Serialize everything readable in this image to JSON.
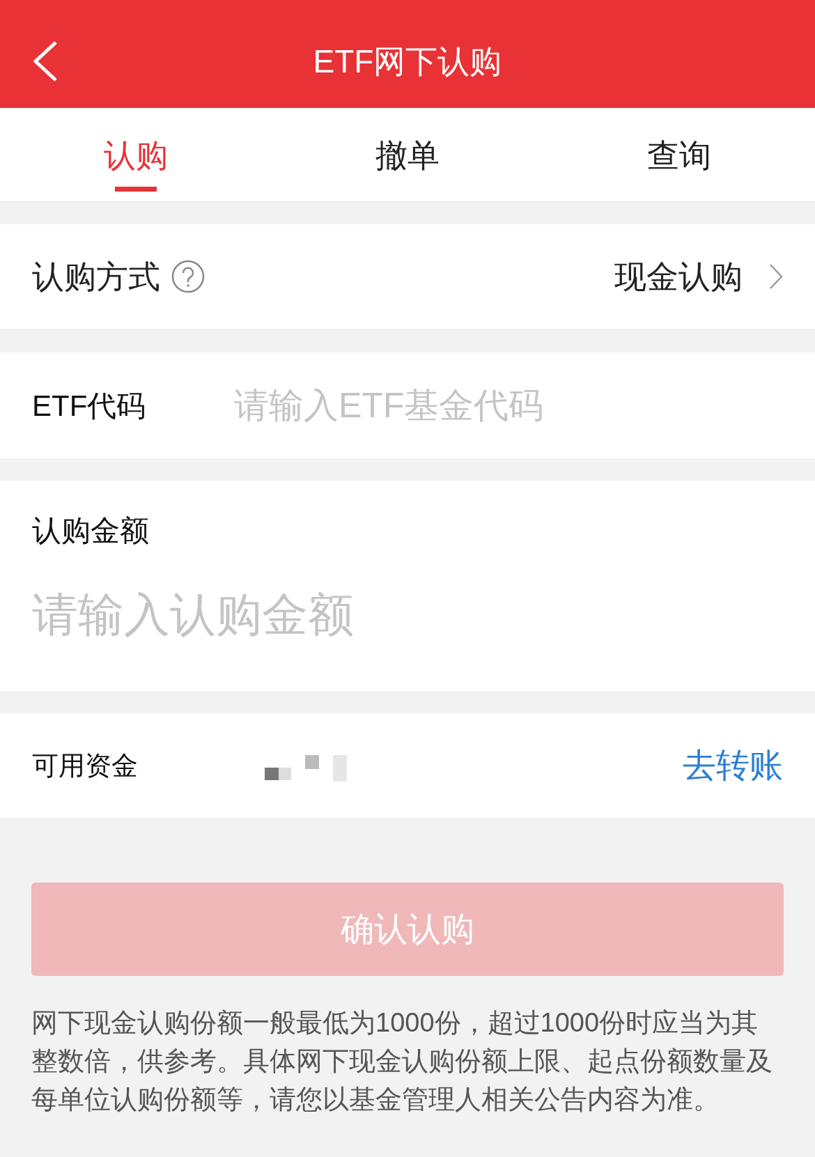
{
  "header": {
    "title": "ETF网下认购"
  },
  "tabs": [
    {
      "label": "认购",
      "selected": true
    },
    {
      "label": "撤单",
      "selected": false
    },
    {
      "label": "查询",
      "selected": false
    }
  ],
  "method": {
    "label": "认购方式",
    "value": "现金认购"
  },
  "etf_code": {
    "label": "ETF代码",
    "placeholder": "请输入ETF基金代码"
  },
  "amount": {
    "label": "认购金额",
    "placeholder": "请输入认购金额"
  },
  "funds": {
    "label": "可用资金",
    "link": "去转账"
  },
  "confirm_button": {
    "label": "确认认购",
    "disabled": true
  },
  "note": "网下现金认购份额一般最低为1000份，超过1000份时应当为其整数倍，供参考。具体网下现金认购份额上限、起点份额数量及每单位认购份额等，请您以基金管理人相关公告内容为准。"
}
